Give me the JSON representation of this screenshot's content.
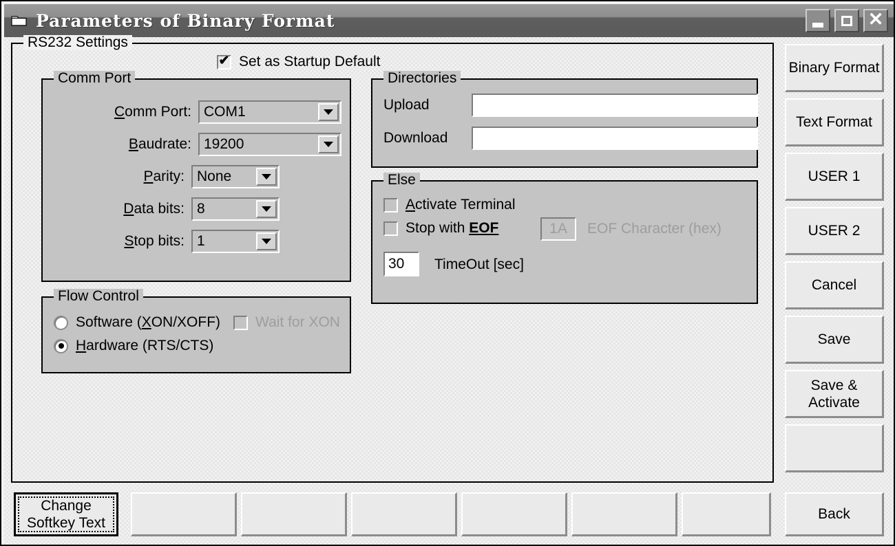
{
  "window": {
    "title": "Parameters of Binary Format",
    "icon": "folder-icon",
    "minimize_label": "Minimize",
    "maximize_label": "Maximize",
    "close_label": "Close",
    "titlebar_color": "#5e5e5e",
    "panel_color": "#f1f1f1",
    "group_color": "#c4c4c4"
  },
  "rs232": {
    "legend": "RS232 Settings",
    "startup_default": {
      "label": "Set  as Startup Default",
      "checked": true,
      "mark": "✔"
    }
  },
  "comm_port": {
    "legend": "Comm Port",
    "fields": [
      {
        "label": "Comm Port:",
        "accel": "C",
        "label_rest": "omm Port:",
        "value": "COM1"
      },
      {
        "label": "Baudrate:",
        "accel": "B",
        "label_rest": "audrate:",
        "value": "19200"
      },
      {
        "label": "Parity:",
        "accel": "P",
        "label_rest": "arity:",
        "value": "None"
      },
      {
        "label": "Data bits:",
        "accel": "D",
        "label_rest": "ata bits:",
        "value": "8"
      },
      {
        "label": "Stop bits:",
        "accel": "S",
        "label_rest": "top bits:",
        "value": "1"
      }
    ]
  },
  "flow_control": {
    "legend": "Flow Control",
    "options": [
      {
        "accel": "X",
        "pre": "Software (",
        "post": "ON/XOFF)",
        "selected": false
      },
      {
        "accel": "H",
        "pre": "",
        "post": "ardware (RTS/CTS)",
        "selected": true
      }
    ],
    "wait_for_xon": {
      "label": "Wait for XON",
      "checked": false,
      "disabled": true
    }
  },
  "directories": {
    "legend": "Directories",
    "upload": {
      "label": "Upload",
      "value": "",
      "placeholder": ""
    },
    "download": {
      "label": "Download",
      "value": "",
      "placeholder": ""
    }
  },
  "else_box": {
    "legend": "Else",
    "activate_terminal": {
      "accel": "A",
      "label_rest": "ctivate Terminal",
      "checked": false
    },
    "stop_with_eof": {
      "pre": "Stop with  ",
      "accel": "EOF",
      "checked": false
    },
    "eof_character": {
      "value": "1A",
      "label": "EOF Character (hex)",
      "disabled": true
    },
    "timeout": {
      "value": "30",
      "label": "TimeOut [sec]"
    }
  },
  "side_buttons": [
    {
      "label": "Binary Format"
    },
    {
      "label": "Text Format"
    },
    {
      "label": "USER 1"
    },
    {
      "label": "USER 2"
    },
    {
      "label": "Cancel"
    },
    {
      "label": "Save"
    },
    {
      "label": "Save &\nActivate"
    },
    {
      "label": ""
    }
  ],
  "softkeys": [
    {
      "label": "Change\nSoftkey Text",
      "focused": true
    },
    {
      "label": "",
      "focused": false
    },
    {
      "label": "",
      "focused": false
    },
    {
      "label": "",
      "focused": false
    },
    {
      "label": "",
      "focused": false
    },
    {
      "label": "",
      "focused": false
    },
    {
      "label": "",
      "focused": false
    }
  ],
  "back_button": {
    "label": "Back"
  }
}
